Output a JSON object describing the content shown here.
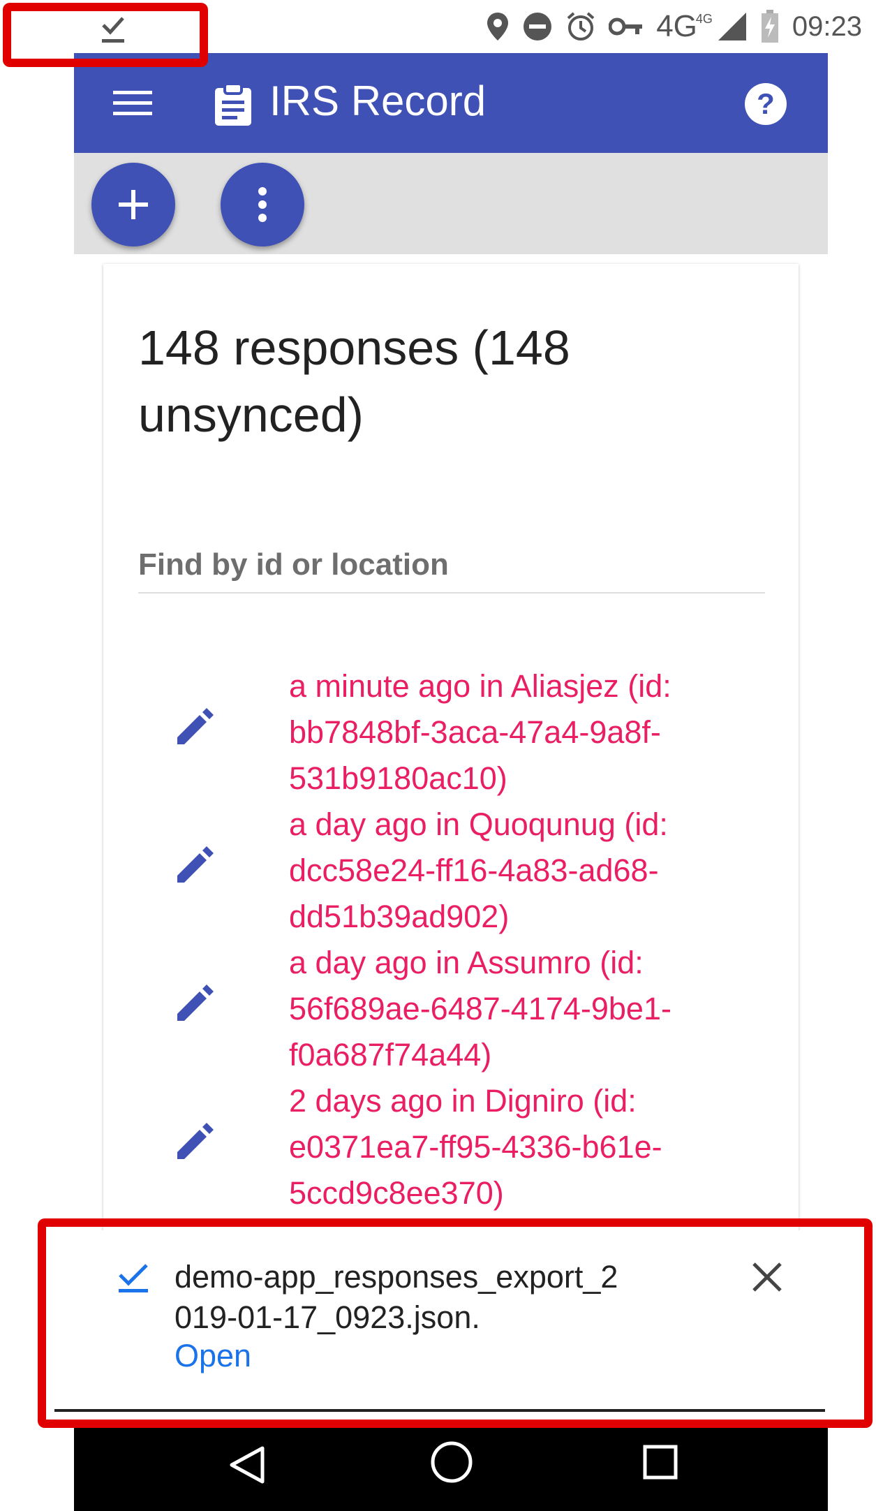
{
  "status_bar": {
    "time": "09:23",
    "network": "4G",
    "network_small": "4G",
    "icons": [
      "download-done-icon",
      "location-icon",
      "do-not-disturb-icon",
      "alarm-icon",
      "vpn-key-icon",
      "signal-icon",
      "battery-charging-icon"
    ]
  },
  "app_bar": {
    "title": "IRS Record",
    "icons": [
      "menu-icon",
      "clipboard-icon",
      "help-icon"
    ]
  },
  "toolbar": {
    "buttons": [
      {
        "icon": "plus-icon",
        "symbol": "+"
      },
      {
        "icon": "more-vertical-icon"
      }
    ]
  },
  "card": {
    "title": "148 responses (148 unsynced)",
    "search": {
      "placeholder": "Find by id or location",
      "value": ""
    },
    "responses": [
      {
        "text": "a minute ago in Aliasjez (id: bb7848bf-3aca-47a4-9a8f-531b9180ac10)",
        "icon": "edit-icon"
      },
      {
        "text": "a day ago in Quoqunug (id: dcc58e24-ff16-4a83-ad68-dd51b39ad902)",
        "icon": "edit-icon"
      },
      {
        "text": "a day ago in Assumro (id: 56f689ae-6487-4174-9be1-f0a687f74a44)",
        "icon": "edit-icon"
      },
      {
        "text": "2 days ago in Digniro (id: e0371ea7-ff95-4336-b61e-5ccd9c8ee370)",
        "icon": "edit-icon"
      }
    ]
  },
  "snackbar": {
    "filename": "demo-app_responses_export_2019-01-17_0923.json.",
    "action": "Open",
    "icons": [
      "check-icon",
      "close-icon"
    ]
  },
  "nav_bar": {
    "icons": [
      "back-icon",
      "home-icon",
      "recents-icon"
    ]
  },
  "colors": {
    "primary": "#3f51b5",
    "accent_text": "#e91e63",
    "toolbar_bg": "#e0e0e0",
    "link": "#1a73e8",
    "highlight": "#e00000"
  }
}
